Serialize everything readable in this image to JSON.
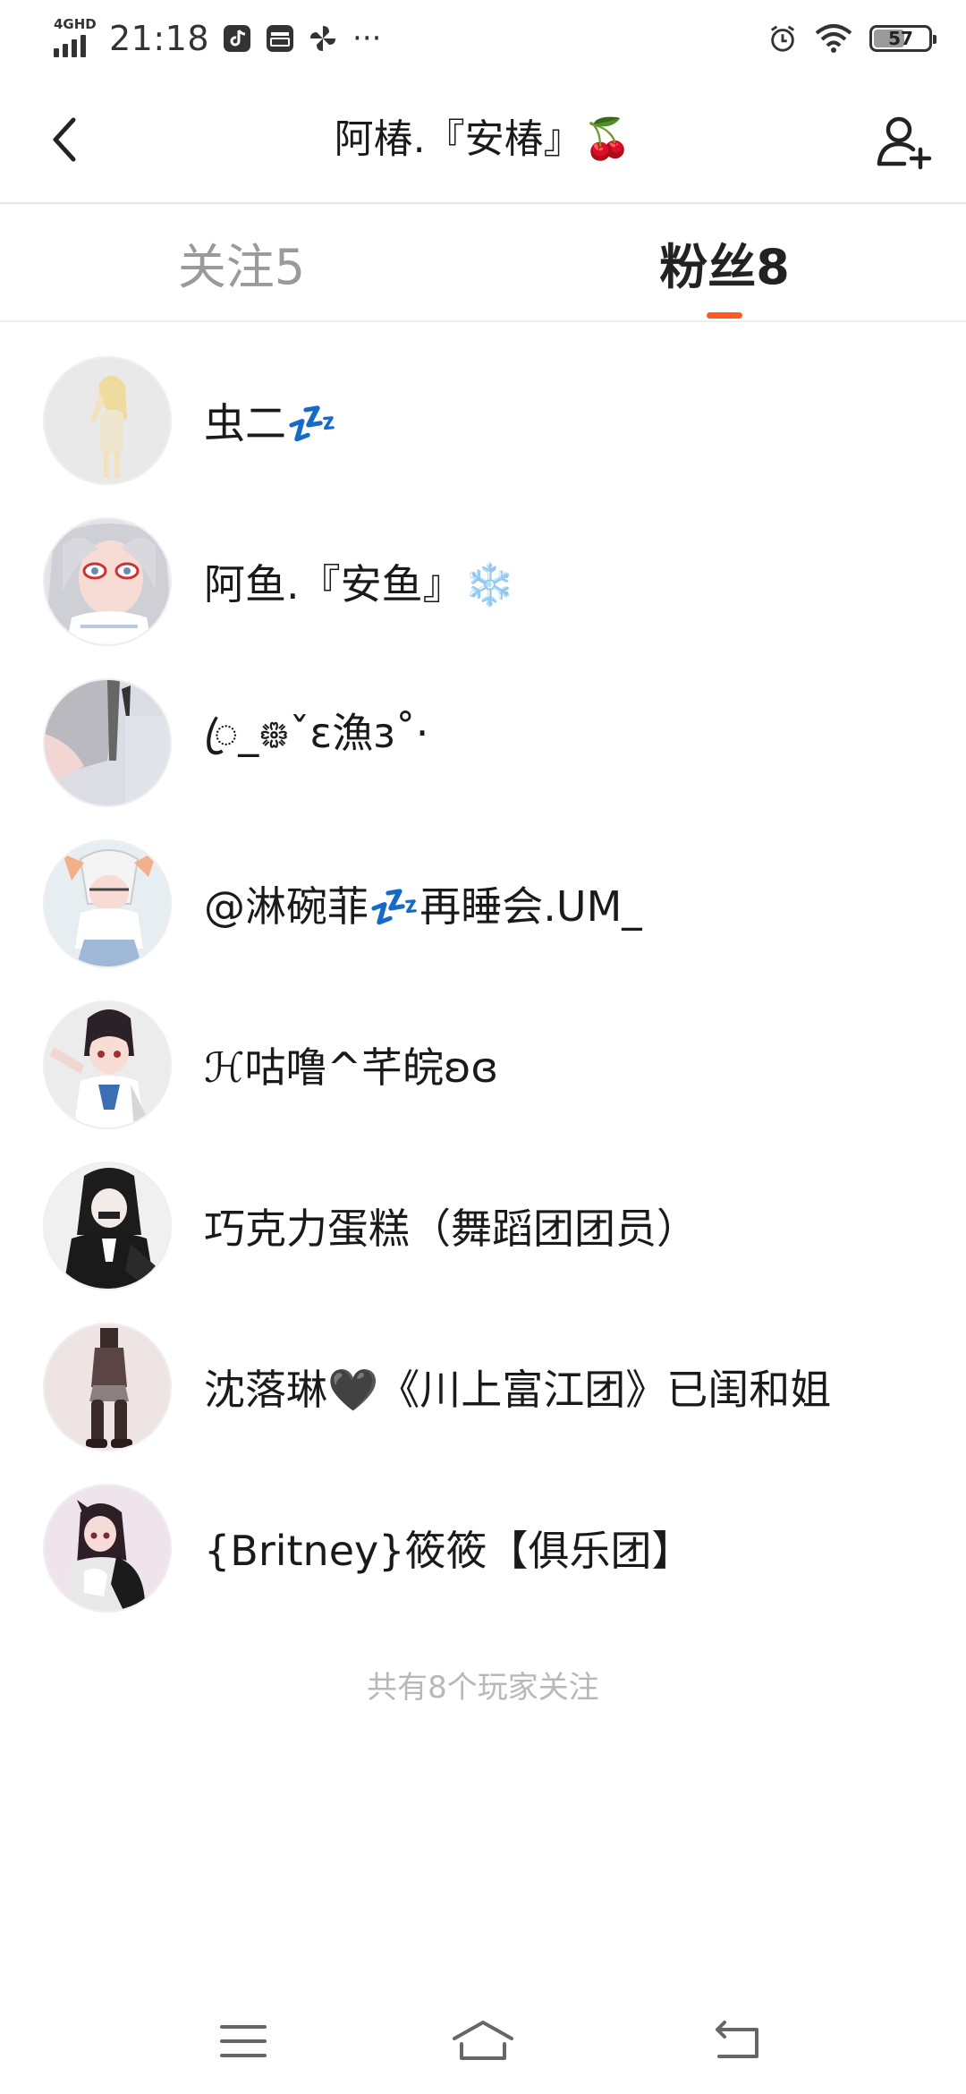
{
  "status_bar": {
    "network": "4GHD",
    "time": "21:18",
    "battery": "57",
    "battery_level": 0.57,
    "more": "···",
    "icons": [
      "music-app-icon",
      "wallet-app-icon",
      "pinwheel-app-icon",
      "alarm-icon",
      "wifi-icon",
      "battery-icon"
    ]
  },
  "header": {
    "title": "阿椿.『安椿』🍒",
    "back_icon": "chevron-left-icon",
    "add_icon": "add-user-icon"
  },
  "tabs": [
    {
      "label": "关注5",
      "active": false
    },
    {
      "label": "粉丝8",
      "active": true
    }
  ],
  "accent_color": "#ff5a1f",
  "followers": [
    {
      "name": "虫二💤"
    },
    {
      "name": "阿鱼.『安鱼』❄️"
    },
    {
      "name": "ꦿ_᪥ˇɛ漁ɜ˚·"
    },
    {
      "name": "@淋碗菲💤再睡会.UM_"
    },
    {
      "name": "ℋ咕噜^芊皖ʚɞ"
    },
    {
      "name": "巧克力蛋糕（舞蹈团团员）"
    },
    {
      "name": "沈落琳🖤《川上富江团》已闺和姐"
    },
    {
      "name": "{Britney}筱筱【俱乐团】"
    }
  ],
  "footer_note": "共有8个玩家关注",
  "nav_bar": {
    "icons": [
      "menu-icon",
      "home-icon",
      "back-arrow-icon"
    ]
  }
}
